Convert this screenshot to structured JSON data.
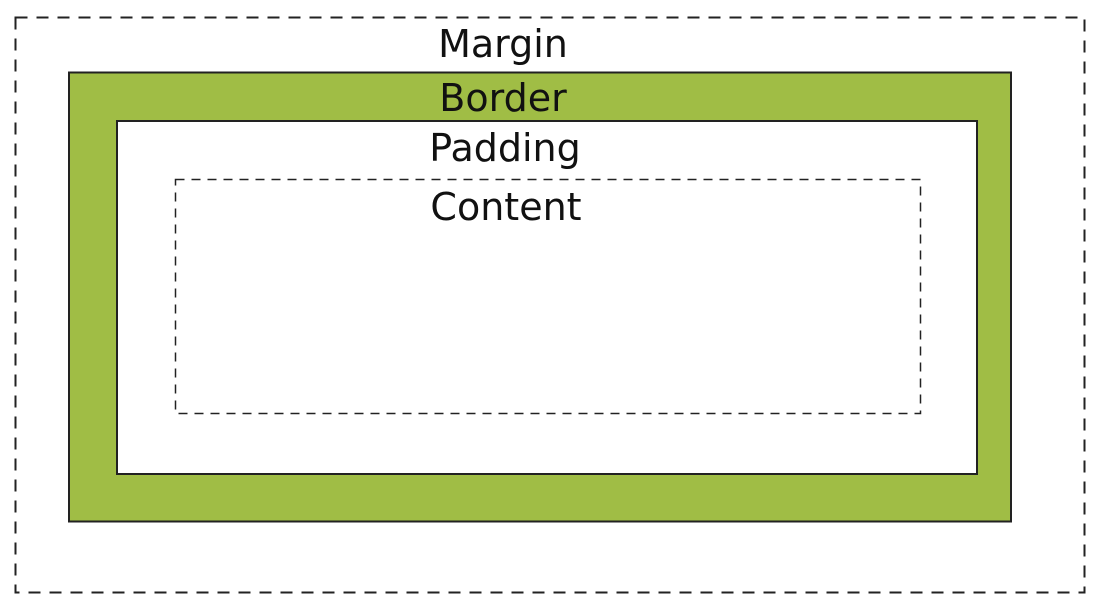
{
  "diagram": {
    "labels": {
      "margin": "Margin",
      "border": "Border",
      "padding": "Padding",
      "content": "Content"
    },
    "colors": {
      "border_fill": "#A0BD45",
      "outline": "#222222",
      "background": "#FFFFFF"
    }
  }
}
